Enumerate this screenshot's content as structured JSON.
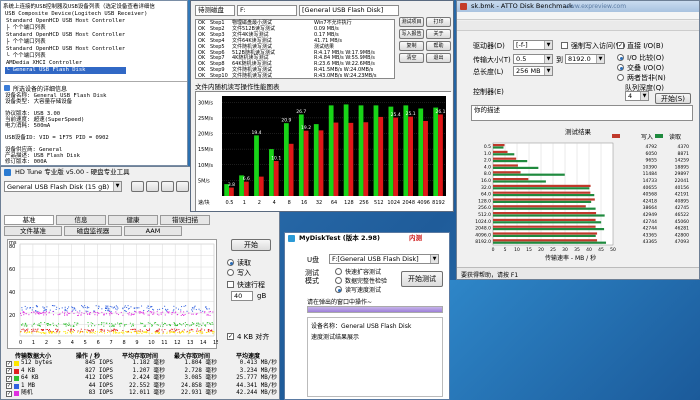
{
  "usbview": {
    "tree": [
      "系统上连接的USB控制器及USB设备列表（选定设备查看详细信",
      "Standard OpenHCD USB Host Controller",
      " ├ 个个端口列表",
      "Standard OpenHCD USB Host Controller",
      " ├ 个个端口列表",
      "Standard OpenHCD USB Host Controller",
      " └ 个个端口列表",
      "AMDedia XHCI Controller",
      "└ General USB Flash Disk"
    ],
    "header_composite": "USB Composite Device(Logitech USB Receiver)",
    "selected_index": 8,
    "info_title": "所选设备的详细信息",
    "info_lines": [
      "设备名称:   General USB Flash Disk",
      "设备类型:   大容量存储设备",
      "",
      "协议版本:   USB 3.00",
      "当前速度:   超速(SuperSpeed)",
      "电力消耗:   500mA",
      "",
      "USB设备ID:  VID = 1F75 PID = 0902",
      "",
      "设备供应商: General",
      "产品描述:   USB Flash Disk",
      "修订版本:   000A"
    ]
  },
  "hdtune": {
    "title": "HD Tune 专业版 v5.00 - 硬盘专业工具",
    "drive": "General USB Flash Disk  (15 gB)",
    "exit_label": "退出",
    "tabs": [
      "基准",
      "信息",
      "健康",
      "错误扫描",
      "文件基准",
      "磁盘监视器",
      "AAM"
    ],
    "start": "开始",
    "options": [
      "读取",
      "写入",
      "快速行程",
      "4 KB 对齐"
    ],
    "quick_value": "40",
    "quick_unit": "gB",
    "y_unit": "ms",
    "y_labels": [
      "80",
      "60",
      "40",
      "20"
    ],
    "x_labels": [
      "0",
      "1",
      "2",
      "3",
      "4",
      "5",
      "6",
      "7",
      "8",
      "9",
      "10",
      "11",
      "12",
      "13",
      "14",
      "15gB"
    ],
    "table_headers": [
      "传输数据大小",
      "操作 / 秒",
      "平均存取时间",
      "最大存取时间",
      "平均速度"
    ],
    "rows": [
      {
        "size": "512 bytes",
        "iops": "845 IOPS",
        "avg": "1.182 毫秒",
        "max": "1.804 毫秒",
        "speed": "0.413 MB/秒",
        "color": "#ffe700"
      },
      {
        "size": "4 KB",
        "iops": "827 IOPS",
        "avg": "1.207 毫秒",
        "max": "2.728 毫秒",
        "speed": "3.234 MB/秒",
        "color": "#e02020"
      },
      {
        "size": "64 KB",
        "iops": "412 IOPS",
        "avg": "2.424 毫秒",
        "max": "3.085 毫秒",
        "speed": "25.777 MB/秒",
        "color": "#30c030"
      },
      {
        "size": "1 MB",
        "iops": "44 IOPS",
        "avg": "22.552 毫秒",
        "max": "24.858 毫秒",
        "speed": "44.341 MB/秒",
        "color": "#3060e0"
      },
      {
        "size": "随机",
        "iops": "83 IOPS",
        "avg": "12.011 毫秒",
        "max": "22.931 毫秒",
        "speed": "42.244 MB/秒",
        "color": "#e030e0"
      }
    ]
  },
  "uspeed": {
    "left_header": "待测磁盘",
    "left_value": "F:",
    "right_header": "[General USB Flash Disk]",
    "steps": [
      {
        "ok": "OK",
        "step": "Step1",
        "desc": "物理磁盘最小测试",
        "val": "Win7不允许执行"
      },
      {
        "ok": "OK",
        "step": "Step2",
        "desc": "文件512B读写测试",
        "val": "0.09 MB/s"
      },
      {
        "ok": "OK",
        "step": "Step3",
        "desc": "文件4K读写测试",
        "val": "0.17 MB/s"
      },
      {
        "ok": "OK",
        "step": "Step4",
        "desc": "文件64K读写测试",
        "val": "41.71 MB/s"
      },
      {
        "ok": "OK",
        "step": "Step5",
        "desc": "文件随机读写测试",
        "val": "测试结果"
      },
      {
        "ok": "OK",
        "step": "Step6",
        "desc": "512B随机读写测试",
        "val": "R:4.17 MB/s W:17.9MB/s"
      },
      {
        "ok": "OK",
        "step": "Step7",
        "desc": "4K随机读写测试",
        "val": "R:4.84 MB/s W:55.9MB/s"
      },
      {
        "ok": "OK",
        "step": "Step8",
        "desc": "64K随机读写测试",
        "val": "R:23.6 MB/s W:22.6MB/s"
      },
      {
        "ok": "OK",
        "step": "Step9",
        "desc": "文件随机读写测试",
        "val": "R:41.5MB/s W:24.0MB/s"
      },
      {
        "ok": "OK",
        "step": "Step10",
        "desc": "文件随机读写测试",
        "val": "R:43.0MB/s W:24.23MB/s"
      }
    ],
    "side_buttons": [
      "测试项目",
      "写入报告",
      "复制",
      "清空",
      "打印",
      "关于",
      "帮助",
      "退出"
    ],
    "side_values": [
      "",
      "",
      "",
      "",
      "",
      ""
    ],
    "chart_title": "文件内随机读写操作性能图表",
    "y_labels": [
      "30M/s",
      "25M/s",
      "20M/s",
      "15M/s",
      "10M/s",
      "5M/s"
    ],
    "x_prefix": "速/块"
  },
  "atto": {
    "title": "sk.bmk - ATTO Disk Benchmark",
    "watermark": "www.expreview.com",
    "drive_label": "驱动器(D)",
    "drive_value": "[-f-]",
    "transfer_label": "传输大小(T)",
    "transfer_from": "0.5",
    "transfer_to": "8192.0",
    "total_label": "总长度(L)",
    "total_value": "256 MB",
    "force_label": "强制写入访问(W)",
    "direct_label": "直接 I/O(B)",
    "io_compare": "I/O 比较(O)",
    "io_overlap": "交叠 I/O(O)",
    "neither": "两者皆非(N)",
    "queue_label": "队列深度(Q)",
    "queue_value": "4",
    "desc_label": "控制器(E)",
    "desc_btn": "开始(S)",
    "comment": "你的描述",
    "results_title": "测试结果",
    "read_label": "写入",
    "write_label": "读取",
    "axis_title": "传输速率 - MB / 秒",
    "status": "要获得帮助，请按 F1",
    "x_ticks": [
      "0",
      "5",
      "10",
      "15",
      "20",
      "25",
      "30",
      "35",
      "40",
      "45",
      "50"
    ]
  },
  "mydisk": {
    "title": "MyDiskTest (版本 2.98)",
    "badge": "内测",
    "drive_label": "U盘",
    "drive_value": "F:[General USB Flash Disk]",
    "mode_label": "测试模式",
    "modes": [
      "快速扩容测试",
      "数据完整性检验",
      "读写速度测试"
    ],
    "start": "开始测试",
    "progress_label": "请在弹出的窗口中操作~",
    "device_name": "设备名称：General USB Flash Disk",
    "speed_label": "速度测试结果展示"
  },
  "chart_data": [
    {
      "type": "bar",
      "title": "文件内随机读写操作性能图表",
      "categories": [
        "0.5",
        "1",
        "2",
        "4",
        "8",
        "16",
        "32",
        "64",
        "128",
        "256",
        "512",
        "1024",
        "2048",
        "4096",
        "8192"
      ],
      "series": [
        {
          "values": [
            3.8,
            6.6,
            19.4,
            15,
            23.3,
            26.1,
            23,
            29,
            29.3,
            29,
            29,
            28.6,
            29,
            28,
            28.3
          ]
        },
        {
          "values": [
            2.7,
            4.6,
            6.2,
            11.2,
            16.7,
            20.9,
            21,
            23.5,
            23.4,
            23.6,
            25.3,
            25.1,
            25.4,
            24,
            26.1
          ]
        }
      ],
      "data_labels": [
        {
          "i": 0,
          "s": 1,
          "text": "3.8"
        },
        {
          "i": 1,
          "s": 1,
          "text": "6.6"
        },
        {
          "i": 2,
          "s": 0,
          "text": "19.4"
        },
        {
          "i": 3,
          "s": 1,
          "text": "10.1"
        },
        {
          "i": 4,
          "s": 0,
          "text": "20.9"
        },
        {
          "i": 5,
          "s": 0,
          "text": "26.7"
        },
        {
          "i": 5,
          "s": 1,
          "text": "19.2"
        },
        {
          "i": 11,
          "s": 1,
          "text": "25.4"
        },
        {
          "i": 12,
          "s": 1,
          "text": "25.1"
        },
        {
          "i": 14,
          "s": 1,
          "text": "26.1"
        }
      ],
      "ylim": [
        0,
        32
      ]
    },
    {
      "type": "bar",
      "title": "测试结果",
      "categories": [
        "0.5",
        "1.0",
        "2.0",
        "4.0",
        "8.0",
        "16.0",
        "32.0",
        "64.0",
        "128.0",
        "256.0",
        "512.0",
        "1024.0",
        "2048.0",
        "4096.0",
        "8192.0"
      ],
      "series": [
        {
          "name": "写入",
          "values": [
            4792,
            6050,
            9655,
            10390,
            11484,
            14733,
            40655,
            40568,
            42418,
            38664,
            42949,
            42744,
            42744,
            43365,
            43365
          ]
        },
        {
          "name": "读取",
          "values": [
            4370,
            8871,
            14259,
            18895,
            29897,
            22041,
            40156,
            42191,
            40895,
            42745,
            46522,
            45060,
            46281,
            42800,
            47093
          ]
        }
      ],
      "xlabel": "传输速率 - MB / 秒",
      "xlim": [
        0,
        50
      ]
    }
  ]
}
